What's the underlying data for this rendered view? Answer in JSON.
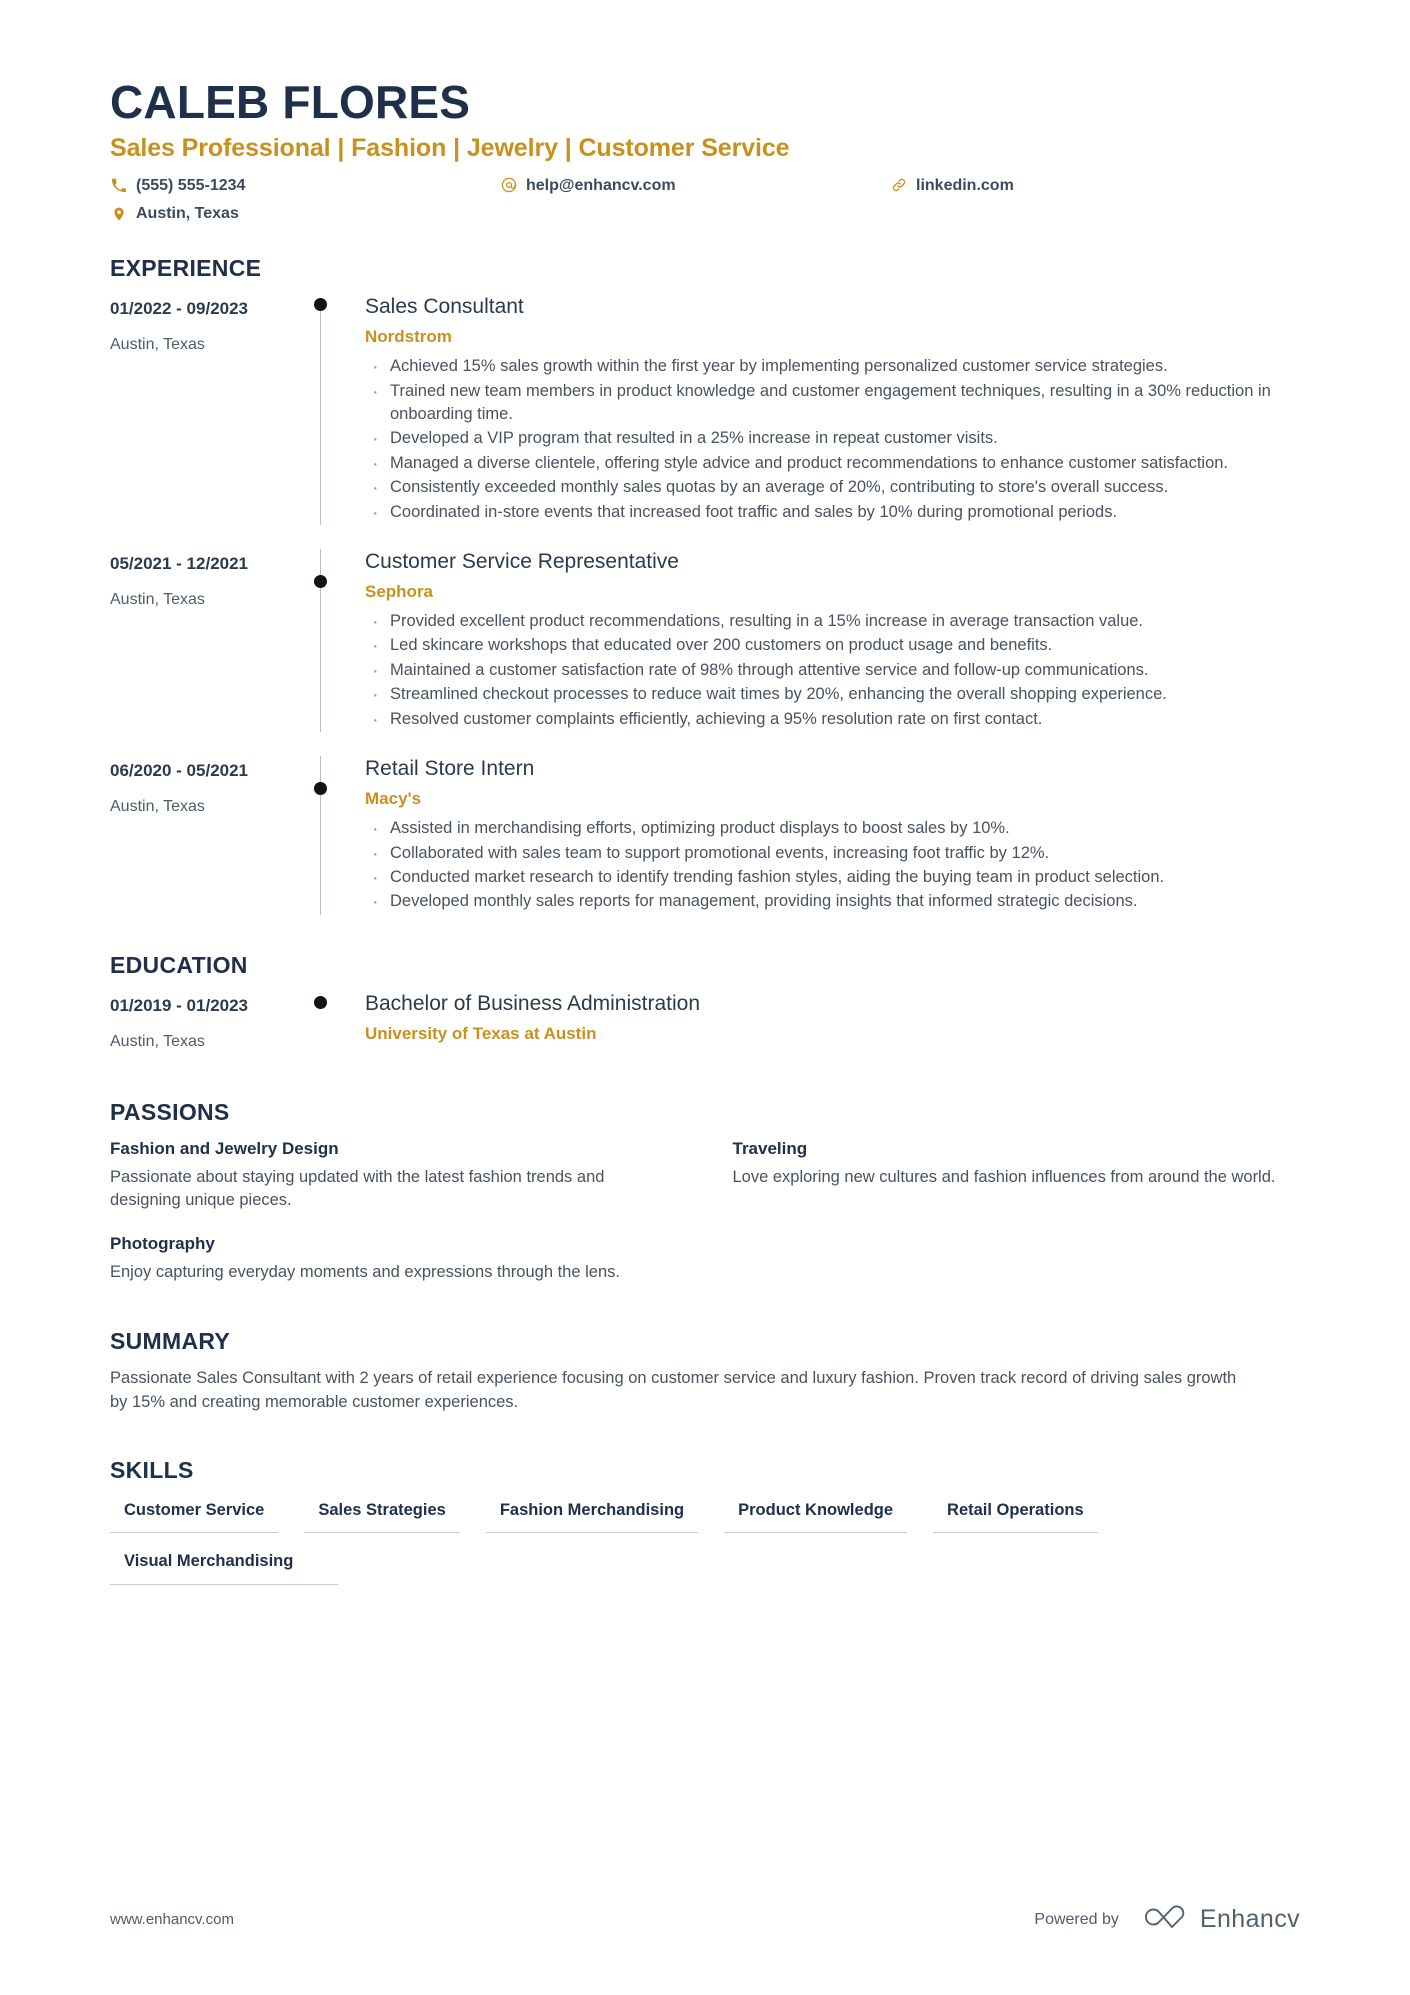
{
  "theme": {
    "accent": "#c8911e",
    "navy": "#20304a",
    "body_text": "#48535f",
    "rule": "#c9cdd2"
  },
  "header": {
    "full_name": "CALEB FLORES",
    "headline": "Sales Professional | Fashion | Jewelry | Customer Service",
    "contacts": [
      {
        "icon": "phone-icon",
        "text": "(555) 555-1234"
      },
      {
        "icon": "email-icon",
        "text": "help@enhancv.com"
      },
      {
        "icon": "link-icon",
        "text": "linkedin.com"
      },
      {
        "icon": "location-pin-icon",
        "text": "Austin, Texas"
      }
    ]
  },
  "experience": {
    "title": "EXPERIENCE",
    "entries": [
      {
        "dates": "01/2022 - 09/2023",
        "location": "Austin, Texas",
        "job_title": "Sales Consultant",
        "organization": "Nordstrom",
        "bullets": [
          "Achieved 15% sales growth within the first year by implementing personalized customer service strategies.",
          "Trained new team members in product knowledge and customer engagement techniques, resulting in a 30% reduction in onboarding time.",
          "Developed a VIP program that resulted in a 25% increase in repeat customer visits.",
          "Managed a diverse clientele, offering style advice and product recommendations to enhance customer satisfaction.",
          "Consistently exceeded monthly sales quotas by an average of 20%, contributing to store's overall success.",
          "Coordinated in-store events that increased foot traffic and sales by 10% during promotional periods."
        ]
      },
      {
        "dates": "05/2021 - 12/2021",
        "location": "Austin, Texas",
        "job_title": "Customer Service Representative",
        "organization": "Sephora",
        "bullets": [
          "Provided excellent product recommendations, resulting in a 15% increase in average transaction value.",
          "Led skincare workshops that educated over 200 customers on product usage and benefits.",
          "Maintained a customer satisfaction rate of 98% through attentive service and follow-up communications.",
          "Streamlined checkout processes to reduce wait times by 20%, enhancing the overall shopping experience.",
          "Resolved customer complaints efficiently, achieving a 95% resolution rate on first contact."
        ]
      },
      {
        "dates": "06/2020 - 05/2021",
        "location": "Austin, Texas",
        "job_title": "Retail Store Intern",
        "organization": "Macy's",
        "bullets": [
          "Assisted in merchandising efforts, optimizing product displays to boost sales by 10%.",
          "Collaborated with sales team to support promotional events, increasing foot traffic by 12%.",
          "Conducted market research to identify trending fashion styles, aiding the buying team in product selection.",
          "Developed monthly sales reports for management, providing insights that informed strategic decisions."
        ]
      }
    ]
  },
  "education": {
    "title": "EDUCATION",
    "entries": [
      {
        "dates": "01/2019 - 01/2023",
        "location": "Austin, Texas",
        "degree": "Bachelor of Business Administration",
        "school": "University of Texas at Austin"
      }
    ]
  },
  "passions": {
    "title": "PASSIONS",
    "items": [
      {
        "name": "Fashion and Jewelry Design",
        "description": "Passionate about staying updated with the latest fashion trends and designing unique pieces."
      },
      {
        "name": "Traveling",
        "description": "Love exploring new cultures and fashion influences from around the world."
      },
      {
        "name": "Photography",
        "description": "Enjoy capturing everyday moments and expressions through the lens."
      }
    ]
  },
  "summary": {
    "title": "SUMMARY",
    "text": "Passionate Sales Consultant with 2 years of retail experience focusing on customer service and luxury fashion. Proven track record of driving sales growth by 15% and creating memorable customer experiences."
  },
  "skills": {
    "title": "SKILLS",
    "items": [
      "Customer Service",
      "Sales Strategies",
      "Fashion Merchandising",
      "Product Knowledge",
      "Retail Operations",
      "Visual Merchandising"
    ]
  },
  "footer": {
    "url": "www.enhancv.com",
    "powered_by": "Powered by",
    "brand": "Enhancv"
  }
}
